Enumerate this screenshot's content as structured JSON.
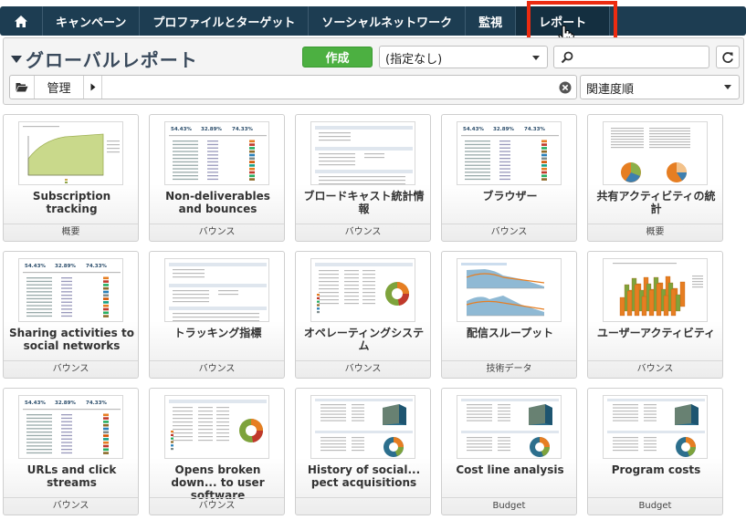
{
  "nav": {
    "tabs": [
      {
        "label": "キャンペーン"
      },
      {
        "label": "プロファイルとターゲット"
      },
      {
        "label": "ソーシャルネットワーク"
      },
      {
        "label": "監視"
      },
      {
        "label": "レポート"
      }
    ],
    "active_tab": "レポート"
  },
  "header": {
    "title": "グローバルレポート",
    "create_label": "作成",
    "filter_value": "(指定なし)",
    "search_value": "",
    "breadcrumb": "管理",
    "sort_value": "関連度順"
  },
  "reports": [
    {
      "name": "Subscription tracking",
      "category": "概要",
      "thumb": "area-chart"
    },
    {
      "name": "Non-deliverables and bounces",
      "category": "バウンス",
      "thumb": "table-report"
    },
    {
      "name": "ブロードキャスト統計情報",
      "category": "バウンス",
      "thumb": "form-report"
    },
    {
      "name": "ブラウザー",
      "category": "バウンス",
      "thumb": "table-report"
    },
    {
      "name": "共有アクティビティの統計",
      "category": "概要",
      "thumb": "pie-report"
    },
    {
      "name": "Sharing activities to social networks",
      "category": "バウンス",
      "thumb": "table-report"
    },
    {
      "name": "トラッキング指標",
      "category": "バウンス",
      "thumb": "form-report"
    },
    {
      "name": "オペレーティングシステム",
      "category": "バウンス",
      "thumb": "donut-report"
    },
    {
      "name": "配信スループット",
      "category": "技術データ",
      "thumb": "throughput-chart"
    },
    {
      "name": "ユーザーアクティビティ",
      "category": "バウンス",
      "thumb": "3d-bar-chart"
    },
    {
      "name": "URLs and click streams",
      "category": "バウンス",
      "thumb": "table-report"
    },
    {
      "name": "Opens broken down... to user software",
      "category": "バウンス",
      "thumb": "donut-report"
    },
    {
      "name": "History of social... pect acquisitions",
      "category": "",
      "thumb": "budget-report"
    },
    {
      "name": "Cost line analysis",
      "category": "Budget",
      "thumb": "budget-report"
    },
    {
      "name": "Program costs",
      "category": "Budget",
      "thumb": "budget-report"
    }
  ],
  "colors": {
    "nav_bg": "#1d3d52",
    "create_green": "#4cb041",
    "highlight_red": "#ec2b10",
    "title_color": "#3a4a5c"
  }
}
